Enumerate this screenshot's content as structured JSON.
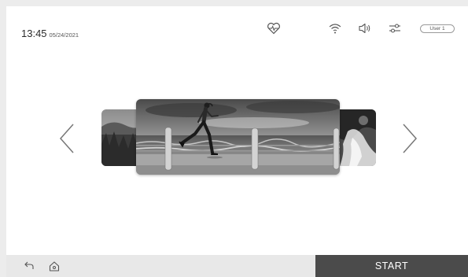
{
  "status": {
    "time": "13:45",
    "date": "05/24/2021"
  },
  "header": {
    "icons": [
      "heart-rate-icon",
      "wifi-icon",
      "volume-icon",
      "settings-sliders-icon"
    ],
    "user_label": "User 1"
  },
  "carousel": {
    "prev_icon": "chevron-left-icon",
    "next_icon": "chevron-right-icon",
    "slides": [
      "grassland-landscape",
      "woman-running-on-beach-promenade",
      "misty-waterfall-landscape"
    ],
    "active_slide": "woman-running-on-beach-promenade"
  },
  "footer": {
    "icons": [
      "back-icon",
      "home-icon"
    ],
    "start_label": "START"
  }
}
